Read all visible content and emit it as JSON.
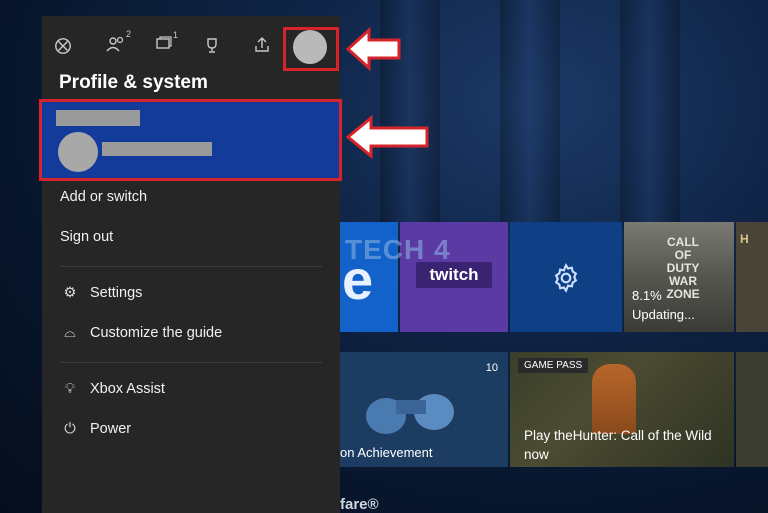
{
  "guide": {
    "heading": "Profile & system",
    "icons": [
      "xbox-icon",
      "friends-icon",
      "parties-icon",
      "achievements-icon",
      "share-icon",
      "profile-avatar"
    ],
    "friends_badge": "2",
    "parties_badge": "1",
    "menu": {
      "add_switch": "Add or switch",
      "sign_out": "Sign out",
      "settings": "Settings",
      "customize": "Customize the guide",
      "assist": "Xbox Assist",
      "power": "Power"
    }
  },
  "background": {
    "twitch_label": "twitch",
    "warzone_title": "CALL OF DUTY WAR ZONE",
    "warzone_progress": "8.1%",
    "warzone_status": "Updating...",
    "edge_tile_label": "H",
    "achievement_score": "10",
    "achievement_text": "on Achievement",
    "gamepass_badge": "GAME PASS",
    "hunter_title": "Play theHunter: Call of the Wild now",
    "bottom_text": "fare®",
    "watermark": "TECH 4"
  },
  "colors": {
    "guide_bg": "#262626",
    "selected_account": "#133b9a",
    "highlight_red": "#d6242a"
  }
}
